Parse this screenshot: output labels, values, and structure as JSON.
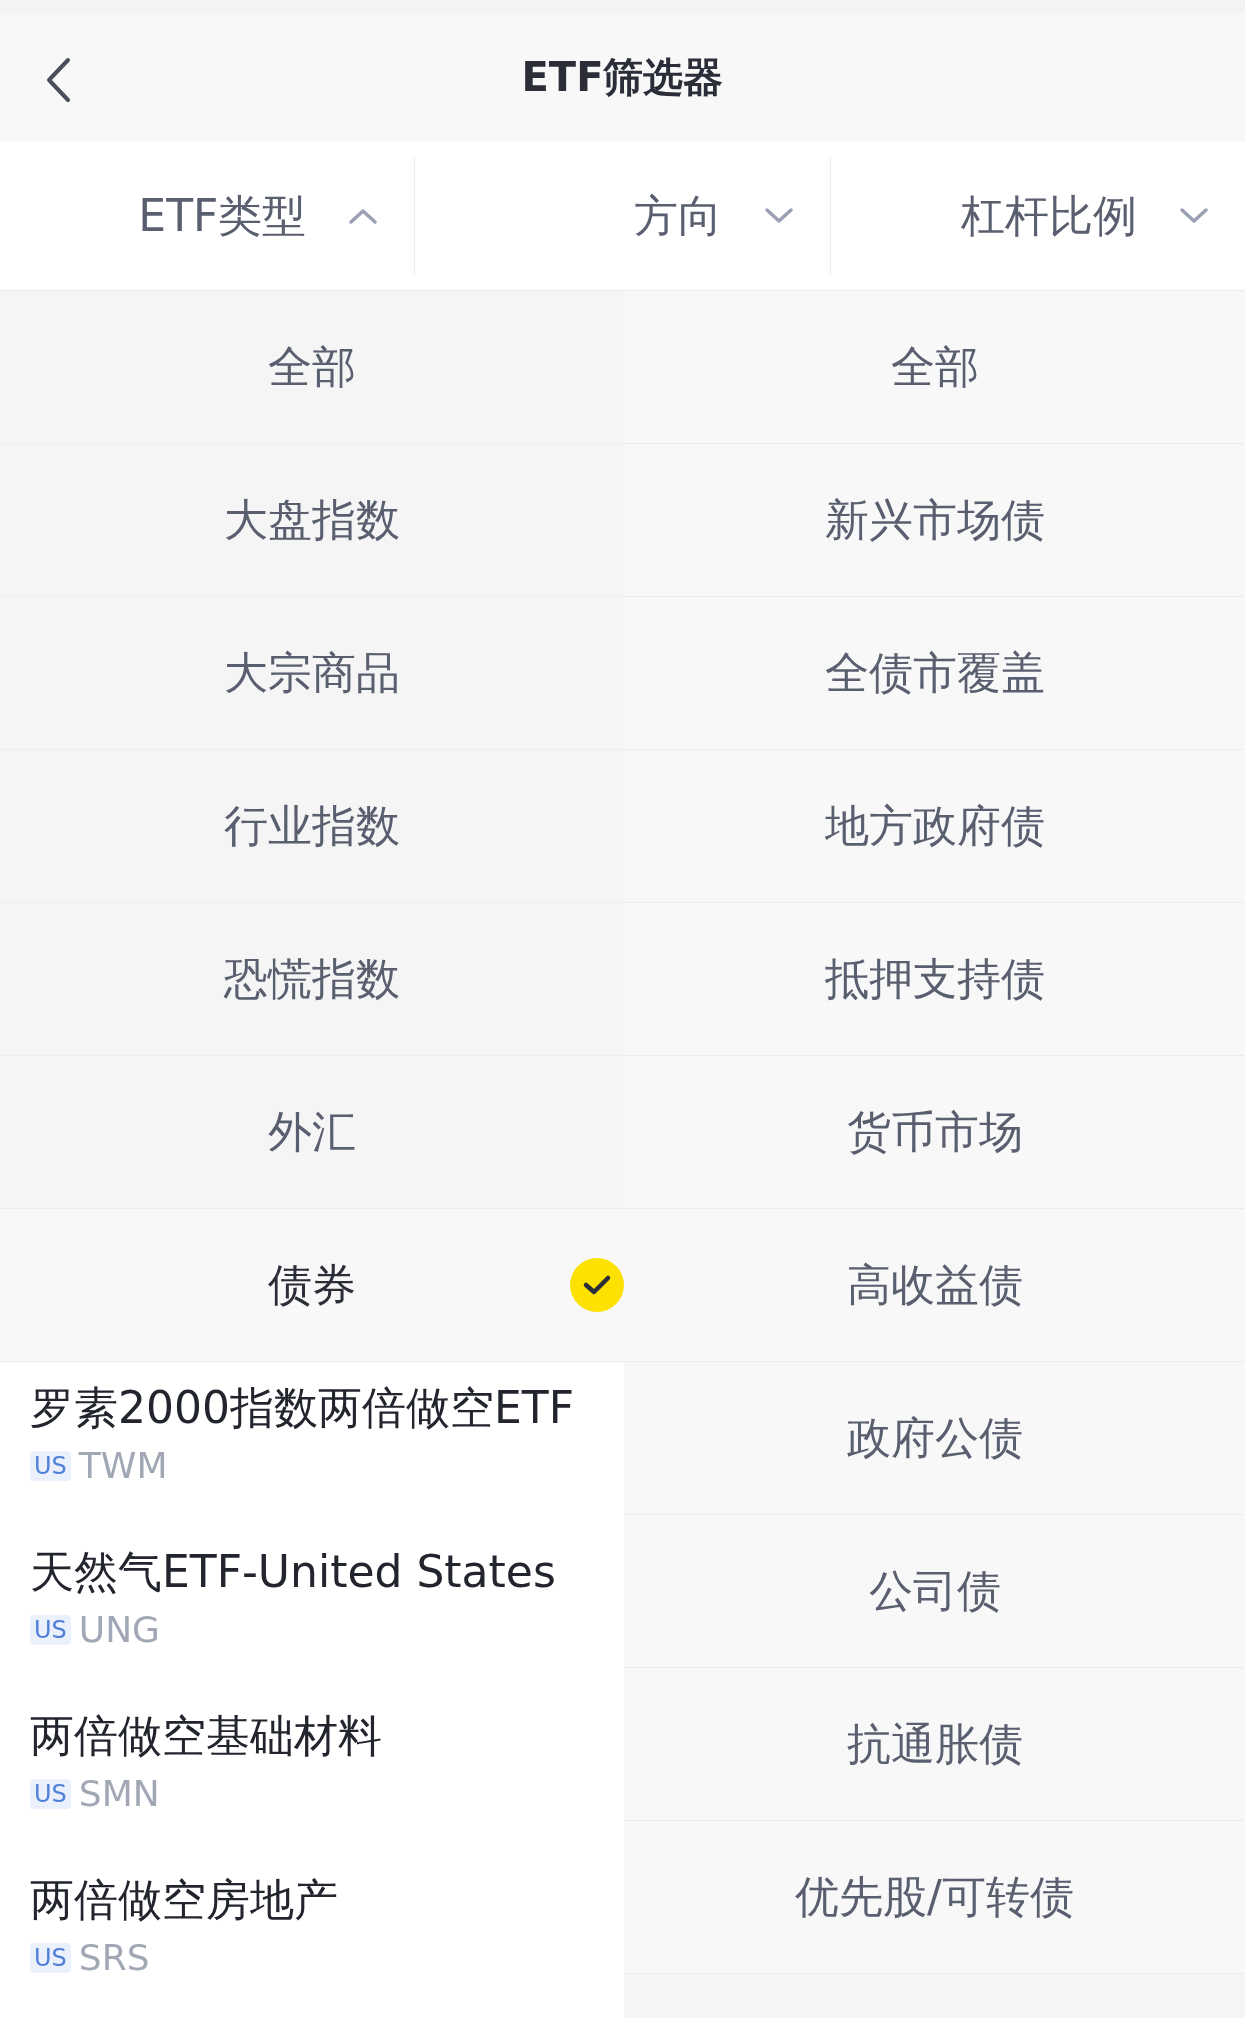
{
  "header": {
    "title": "ETF筛选器"
  },
  "filters": [
    {
      "label": "ETF类型",
      "expanded": true
    },
    {
      "label": "方向",
      "expanded": false
    },
    {
      "label": "杠杆比例",
      "expanded": false
    }
  ],
  "categories": [
    {
      "label": "全部",
      "selected": false
    },
    {
      "label": "大盘指数",
      "selected": false
    },
    {
      "label": "大宗商品",
      "selected": false
    },
    {
      "label": "行业指数",
      "selected": false
    },
    {
      "label": "恐慌指数",
      "selected": false
    },
    {
      "label": "外汇",
      "selected": false
    },
    {
      "label": "债券",
      "selected": true
    }
  ],
  "subcategories": [
    {
      "label": "全部",
      "selected": false
    },
    {
      "label": "新兴市场债",
      "selected": false
    },
    {
      "label": "全债市覆盖",
      "selected": false
    },
    {
      "label": "地方政府债",
      "selected": false
    },
    {
      "label": "抵押支持债",
      "selected": false
    },
    {
      "label": "货币市场",
      "selected": false
    },
    {
      "label": "高收益债",
      "selected": false
    },
    {
      "label": "政府公债",
      "selected": false
    },
    {
      "label": "公司债",
      "selected": false
    },
    {
      "label": "抗通胀债",
      "selected": false
    },
    {
      "label": "优先股/可转债",
      "selected": false
    }
  ],
  "results": [
    {
      "name": "罗素2000指数两倍做空ETF",
      "market": "US",
      "ticker": "TWM"
    },
    {
      "name": "天然气ETF-United States",
      "market": "US",
      "ticker": "UNG"
    },
    {
      "name": "两倍做空基础材料",
      "market": "US",
      "ticker": "SMN"
    },
    {
      "name": "两倍做空房地产",
      "market": "US",
      "ticker": "SRS"
    }
  ]
}
